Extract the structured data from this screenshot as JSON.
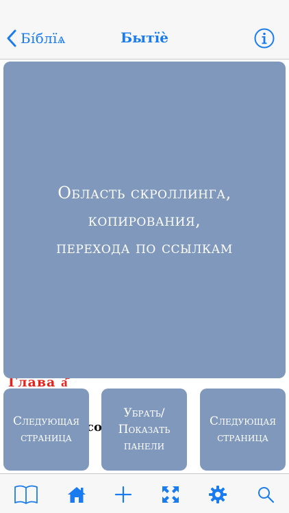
{
  "navbar": {
    "back_label": "Бі́блїѧ",
    "title": "Бытїѐ"
  },
  "background_text": {
    "chapter_heading": "Глава а҃",
    "verse_fragment": "со            не́"
  },
  "overlay": {
    "scroll_area_lines": [
      "Область скроллинга,",
      "копирования,",
      "перехода по ссылкам"
    ],
    "left_button_lines": [
      "Следующая",
      "страница"
    ],
    "middle_button_lines": [
      "Убрать/",
      "Показать",
      "панели"
    ],
    "right_button_lines": [
      "Следующая",
      "страница"
    ]
  },
  "tabbar": {
    "tabs": [
      {
        "icon": "book-icon"
      },
      {
        "icon": "home-icon"
      },
      {
        "icon": "plus-icon"
      },
      {
        "icon": "expand-icon"
      },
      {
        "icon": "gear-icon"
      },
      {
        "icon": "search-icon"
      }
    ]
  },
  "colors": {
    "accent": "#1a7bf0",
    "overlay": "#7f98bb",
    "chapter_red": "#e3231c"
  }
}
